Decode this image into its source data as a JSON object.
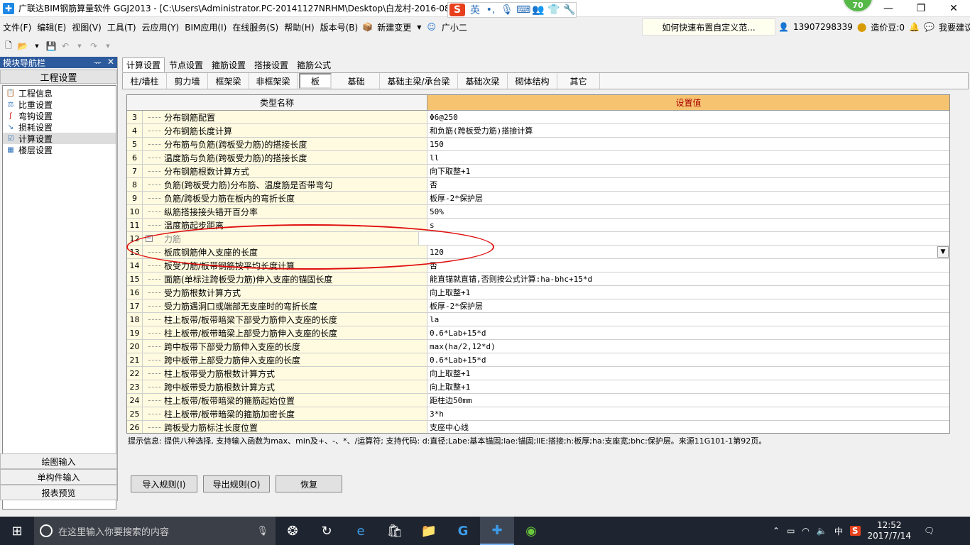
{
  "window": {
    "title": "广联达BIM钢筋算量软件 GGJ2013 - [C:\\Users\\Administrator.PC-20141127NRHM\\Desktop\\白龙村-2016-08-",
    "ime_label": "英",
    "badge": "70",
    "btn_min": "—",
    "btn_max": "❐",
    "btn_close": "✕"
  },
  "menu": [
    {
      "label": "文件(F)"
    },
    {
      "label": "编辑(E)"
    },
    {
      "label": "视图(V)"
    },
    {
      "label": "工具(T)"
    },
    {
      "label": "云应用(Y)"
    },
    {
      "label": "BIM应用(I)"
    },
    {
      "label": "在线服务(S)"
    },
    {
      "label": "帮助(H)"
    },
    {
      "label": "版本号(B)"
    },
    {
      "label": "新建变更"
    },
    {
      "label": "广小二"
    }
  ],
  "menu_link": "如何快速布置自定义范...",
  "menu_right": {
    "phone": "13907298339",
    "coins": "造价豆:0",
    "suggest": "我要建议"
  },
  "sidebar": {
    "header": "模块导航栏",
    "pin": "ᅲ",
    "close": "✕",
    "section": "工程设置",
    "items": [
      {
        "label": "工程信息"
      },
      {
        "label": "比重设置"
      },
      {
        "label": "弯钩设置"
      },
      {
        "label": "损耗设置"
      },
      {
        "label": "计算设置"
      },
      {
        "label": "楼层设置"
      }
    ],
    "bottom": [
      {
        "label": "绘图输入"
      },
      {
        "label": "单构件输入"
      },
      {
        "label": "报表预览"
      }
    ]
  },
  "tabs_top": [
    {
      "label": "计算设置"
    },
    {
      "label": "节点设置"
    },
    {
      "label": "箍筋设置"
    },
    {
      "label": "搭接设置"
    },
    {
      "label": "箍筋公式"
    }
  ],
  "tabs_sub": [
    {
      "label": "柱/墙柱"
    },
    {
      "label": "剪力墙"
    },
    {
      "label": "框架梁"
    },
    {
      "label": "非框架梁"
    },
    {
      "label": "板"
    },
    {
      "label": "基础"
    },
    {
      "label": "基础主梁/承台梁"
    },
    {
      "label": "基础次梁"
    },
    {
      "label": "砌体结构"
    },
    {
      "label": "其它"
    }
  ],
  "grid": {
    "col_type": "类型名称",
    "col_value": "设置值",
    "rows": [
      {
        "num": "3",
        "name": "分布钢筋配置",
        "value": "Φ6@250"
      },
      {
        "num": "4",
        "name": "分布钢筋长度计算",
        "value": "和负筋(跨板受力筋)搭接计算"
      },
      {
        "num": "5",
        "name": "分布筋与负筋(跨板受力筋)的搭接长度",
        "value": "150"
      },
      {
        "num": "6",
        "name": "温度筋与负筋(跨板受力筋)的搭接长度",
        "value": "ll"
      },
      {
        "num": "7",
        "name": "分布钢筋根数计算方式",
        "value": "向下取整+1"
      },
      {
        "num": "8",
        "name": "负筋(跨板受力筋)分布筋、温度筋是否带弯勾",
        "value": "否"
      },
      {
        "num": "9",
        "name": "负筋/跨板受力筋在板内的弯折长度",
        "value": "板厚-2*保护层"
      },
      {
        "num": "10",
        "name": "纵筋搭接接头错开百分率",
        "value": "50%"
      },
      {
        "num": "11",
        "name": "温度筋起步距离",
        "value": "s"
      },
      {
        "num": "12",
        "name": "受力筋",
        "value": ""
      },
      {
        "num": "13",
        "name": "板底钢筋伸入支座的长度",
        "value": "120"
      },
      {
        "num": "14",
        "name": "板受力筋/板带钢筋按平均长度计算",
        "value": "否"
      },
      {
        "num": "15",
        "name": "面筋(单标注跨板受力筋)伸入支座的锚固长度",
        "value": "能直锚就直锚,否则按公式计算:ha-bhc+15*d"
      },
      {
        "num": "16",
        "name": "受力筋根数计算方式",
        "value": "向上取整+1"
      },
      {
        "num": "17",
        "name": "受力筋遇洞口或端部无支座时的弯折长度",
        "value": "板厚-2*保护层"
      },
      {
        "num": "18",
        "name": "柱上板带/板带暗梁下部受力筋伸入支座的长度",
        "value": "la"
      },
      {
        "num": "19",
        "name": "柱上板带/板带暗梁上部受力筋伸入支座的长度",
        "value": "0.6*Lab+15*d"
      },
      {
        "num": "20",
        "name": "跨中板带下部受力筋伸入支座的长度",
        "value": "max(ha/2,12*d)"
      },
      {
        "num": "21",
        "name": "跨中板带上部受力筋伸入支座的长度",
        "value": "0.6*Lab+15*d"
      },
      {
        "num": "22",
        "name": "柱上板带受力筋根数计算方式",
        "value": "向上取整+1"
      },
      {
        "num": "23",
        "name": "跨中板带受力筋根数计算方式",
        "value": "向上取整+1"
      },
      {
        "num": "24",
        "name": "柱上板带/板带暗梁的箍筋起始位置",
        "value": "距柱边50mm"
      },
      {
        "num": "25",
        "name": "柱上板带/板带暗梁的箍筋加密长度",
        "value": "3*h"
      },
      {
        "num": "26",
        "name": "跨板受力筋标注长度位置",
        "value": "支座中心线"
      }
    ]
  },
  "hint": "提示信息: 提供八种选择, 支持输入函数为max、min及+、-、*、/运算符; 支持代码: d:直径;Labe:基本锚固;lae:锚固;llE:搭接;h:板厚;ha:支座宽;bhc:保护层。来源11G101-1第92页。",
  "buttons": {
    "import": "导入规则(I)",
    "export": "导出规则(O)",
    "restore": "恢复"
  },
  "taskbar": {
    "search_placeholder": "在这里输入你要搜索的内容",
    "ime": "中",
    "time": "12:52",
    "date": "2017/7/14"
  },
  "colors": {
    "header_value_bg": "#f6c470",
    "row_name_bg": "#fffbe0",
    "annotation": "#e01010",
    "nav_header": "#2d5a9c"
  }
}
